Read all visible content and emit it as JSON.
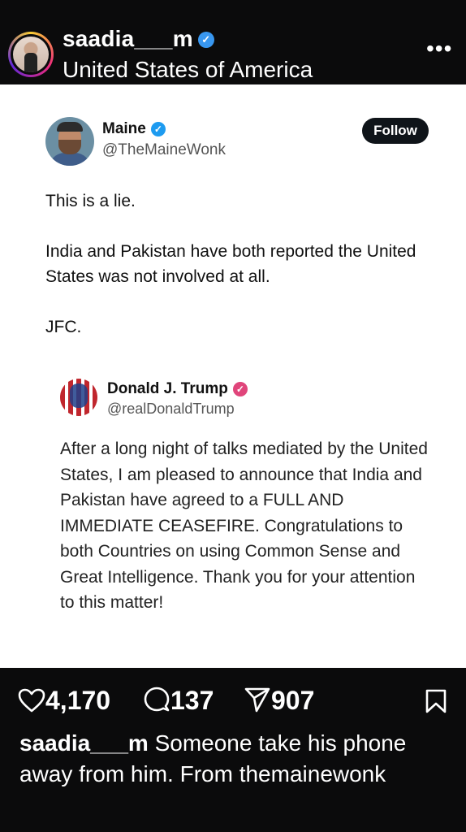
{
  "post": {
    "username": "saadia___m",
    "location": "United States of America",
    "more": "•••"
  },
  "tweet": {
    "name": "Maine",
    "handle": "@TheMaineWonk",
    "follow_label": "Follow",
    "paragraphs": [
      "This is a lie.",
      "India and Pakistan have both reported the United States was not involved at all.",
      "JFC."
    ]
  },
  "quoted": {
    "name": "Donald J. Trump",
    "handle": "@realDonaldTrump",
    "text": "After a long night of talks mediated by the United States, I am pleased to announce that India and Pakistan have agreed to a FULL AND IMMEDIATE CEASEFIRE. Congratulations to both Countries on using Common Sense and Great Intelligence. Thank you for your attention to this matter!"
  },
  "stats": {
    "likes": "4,170",
    "comments": "137",
    "shares": "907"
  },
  "caption": {
    "username": "saadia___m",
    "text": "Someone take his phone away from him. From themainewonk"
  },
  "colors": {
    "background": "#0b0b0c",
    "verified_blue": "#3897f0",
    "tweet_check": "#1d9bf0",
    "quote_badge": "#e0457b"
  },
  "icons": [
    "verified-icon",
    "more-icon",
    "heart-icon",
    "comment-icon",
    "share-icon",
    "bookmark-icon"
  ]
}
